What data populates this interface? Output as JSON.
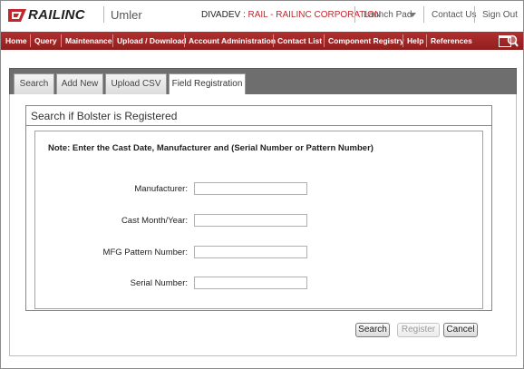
{
  "header": {
    "logo_text": "RAILINC",
    "app_title": "Umler",
    "user_env": "DIVADEV : ",
    "user_company": "RAIL - RAILINC CORPORATION",
    "launch_pad": "Launch Pad",
    "contact_us": "Contact Us",
    "sign_out": "Sign Out",
    "brand_color": "#c0282e"
  },
  "nav": {
    "items": [
      "Home",
      "Query",
      "Maintenance",
      "Upload / Download",
      "Account Administration",
      "Contact List",
      "Component Registry",
      "Help",
      "References"
    ],
    "background": "#a02a29"
  },
  "tabs": [
    {
      "label": "Search",
      "active": false
    },
    {
      "label": "Add New",
      "active": false
    },
    {
      "label": "Upload CSV",
      "active": false
    },
    {
      "label": "Field Registration",
      "active": true
    }
  ],
  "form": {
    "title": "Search if Bolster is Registered",
    "note": "Note: Enter the Cast Date, Manufacturer and (Serial Number or Pattern Number)",
    "fields": [
      {
        "label": "Manufacturer:",
        "value": ""
      },
      {
        "label": "Cast Month/Year:",
        "value": ""
      },
      {
        "label": "MFG Pattern Number:",
        "value": ""
      },
      {
        "label": "Serial Number:",
        "value": ""
      }
    ]
  },
  "buttons": {
    "search": "Search",
    "register": "Register",
    "cancel": "Cancel"
  }
}
